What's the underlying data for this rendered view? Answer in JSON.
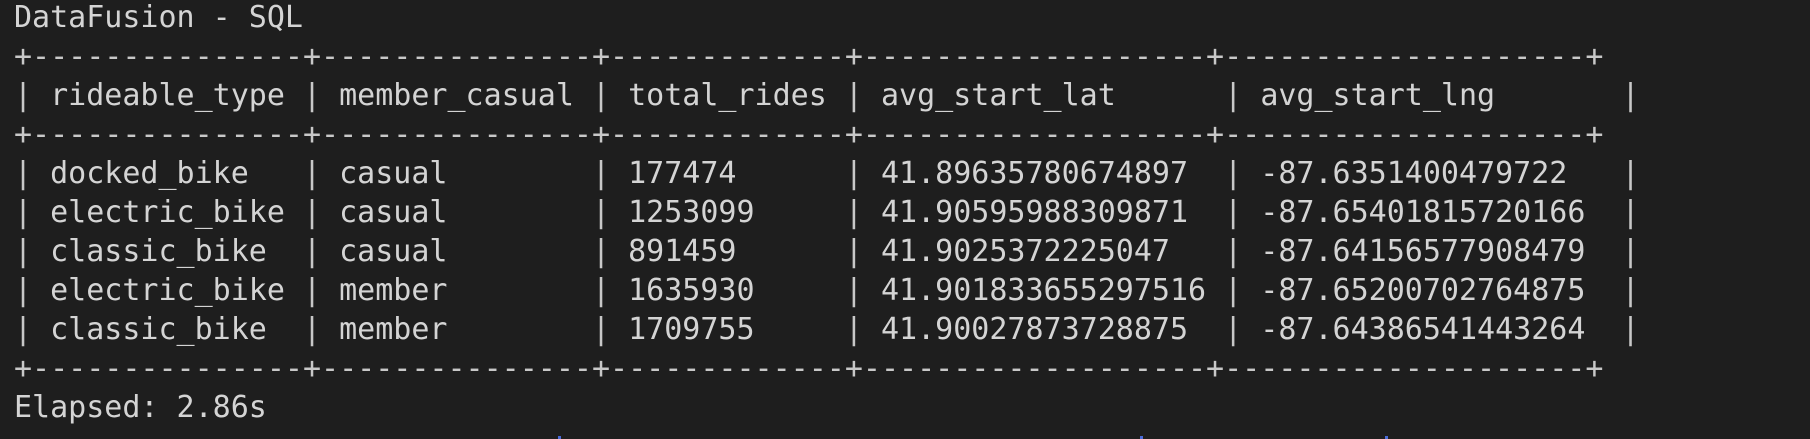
{
  "window": {
    "title": "DataFusion - SQL"
  },
  "table": {
    "columns": [
      "rideable_type",
      "member_casual",
      "total_rides",
      "avg_start_lat",
      "avg_start_lng"
    ],
    "rows": [
      [
        "docked_bike",
        "casual",
        "177474",
        "41.89635780674897",
        "-87.6351400479722"
      ],
      [
        "electric_bike",
        "casual",
        "1253099",
        "41.90595988309871",
        "-87.65401815720166"
      ],
      [
        "classic_bike",
        "casual",
        "891459",
        "41.9025372225047",
        "-87.64156577908479"
      ],
      [
        "electric_bike",
        "member",
        "1635930",
        "41.901833655297516",
        "-87.65200702764875"
      ],
      [
        "classic_bike",
        "member",
        "1709755",
        "41.90027873728875",
        "-87.64386541443264"
      ]
    ]
  },
  "status": {
    "elapsed": "Elapsed: 2.86s"
  }
}
